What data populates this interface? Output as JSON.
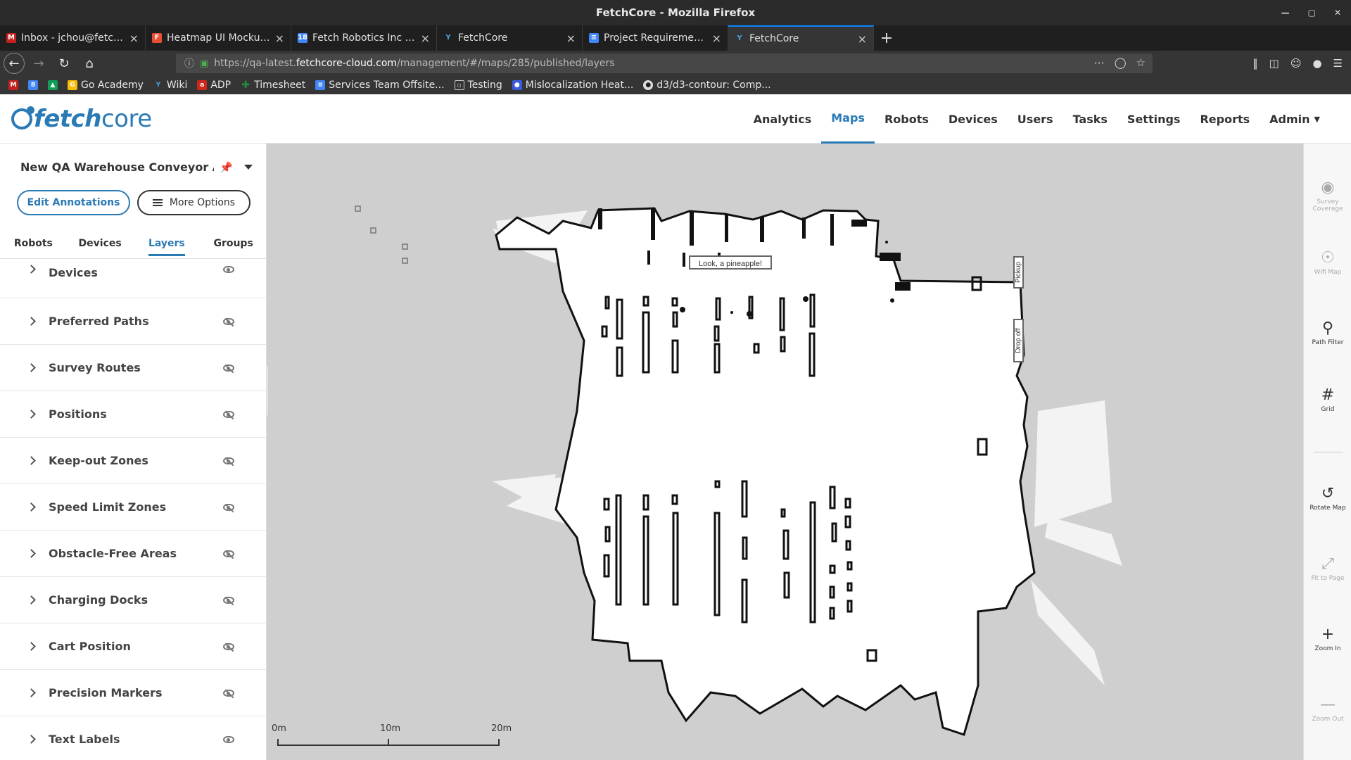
{
  "browser": {
    "window_title": "FetchCore - Mozilla Firefox",
    "tabs": [
      {
        "title": "Inbox - jchou@fetchrobo",
        "icon_color": "#c5221f",
        "active": false
      },
      {
        "title": "Heatmap UI Mockup – Fi",
        "icon_color": "#e94e35",
        "active": false
      },
      {
        "title": "Fetch Robotics Inc - Cale",
        "icon_color": "#4285f4",
        "active": false
      },
      {
        "title": "FetchCore",
        "icon_color": "#2a7ab5",
        "active": false
      },
      {
        "title": "Project Requirements &",
        "icon_color": "#4285f4",
        "active": false
      },
      {
        "title": "FetchCore",
        "icon_color": "#2a7ab5",
        "active": true
      }
    ],
    "url_prefix": "https://qa-latest.",
    "url_host": "fetchcore-cloud.com",
    "url_path": "/management/#/maps/285/published/layers",
    "bookmarks": [
      {
        "label": "",
        "icon_color": "#c5221f"
      },
      {
        "label": "",
        "icon_color": "#4285f4"
      },
      {
        "label": "",
        "icon_color": "#0f9d58"
      },
      {
        "label": "Go Academy",
        "icon_color": "#fbbc05"
      },
      {
        "label": "Wiki",
        "icon_color": "#2a7ab5"
      },
      {
        "label": "ADP",
        "icon_color": "#d0271d"
      },
      {
        "label": "Timesheet",
        "icon_color": "#1e8e3e"
      },
      {
        "label": "Services Team Offsite...",
        "icon_color": "#4285f4"
      },
      {
        "label": "Testing",
        "icon_color": "#888888"
      },
      {
        "label": "Mislocalization Heat...",
        "icon_color": "#3b5bdb"
      },
      {
        "label": "d3/d3-contour: Comp...",
        "icon_color": "#333333"
      }
    ]
  },
  "app": {
    "logo_fetch": "fetch",
    "logo_core": "core",
    "nav": [
      {
        "label": "Analytics",
        "active": false
      },
      {
        "label": "Maps",
        "active": true
      },
      {
        "label": "Robots",
        "active": false
      },
      {
        "label": "Devices",
        "active": false
      },
      {
        "label": "Users",
        "active": false
      },
      {
        "label": "Tasks",
        "active": false
      },
      {
        "label": "Settings",
        "active": false
      },
      {
        "label": "Reports",
        "active": false
      },
      {
        "label": "Admin",
        "active": false
      }
    ],
    "accent_color": "#2a7ab5"
  },
  "sidebar": {
    "map_title": "New QA Warehouse Conveyor Ar ...",
    "edit_annotations_label": "Edit Annotations",
    "more_options_label": "More Options",
    "tabs": [
      {
        "label": "Robots",
        "active": false
      },
      {
        "label": "Devices",
        "active": false
      },
      {
        "label": "Layers",
        "active": true
      },
      {
        "label": "Groups",
        "active": false
      }
    ],
    "layers": [
      {
        "label": "Devices",
        "visible": true
      },
      {
        "label": "Preferred Paths",
        "visible": false
      },
      {
        "label": "Survey Routes",
        "visible": false
      },
      {
        "label": "Positions",
        "visible": false
      },
      {
        "label": "Keep-out Zones",
        "visible": false
      },
      {
        "label": "Speed Limit Zones",
        "visible": false
      },
      {
        "label": "Obstacle-Free Areas",
        "visible": false
      },
      {
        "label": "Charging Docks",
        "visible": false
      },
      {
        "label": "Cart Position",
        "visible": false
      },
      {
        "label": "Precision Markers",
        "visible": false
      },
      {
        "label": "Text Labels",
        "visible": true
      }
    ]
  },
  "map": {
    "text_label": "Look, a pineapple!",
    "pickup_label": "Pickup",
    "dropoff_label": "Drop off",
    "scale_labels": [
      "0m",
      "10m",
      "20m"
    ]
  },
  "toolbar": {
    "tools": [
      {
        "label": "Survey Coverage",
        "icon": "survey-coverage-icon",
        "enabled": false
      },
      {
        "label": "Wifi Map",
        "icon": "wifi-icon",
        "enabled": false
      },
      {
        "label": "Path Filter",
        "icon": "path-filter-icon",
        "enabled": true
      },
      {
        "label": "Grid",
        "icon": "grid-icon",
        "enabled": true
      },
      {
        "label": "Rotate Map",
        "icon": "rotate-icon",
        "enabled": true
      },
      {
        "label": "Fit to Page",
        "icon": "fit-page-icon",
        "enabled": false
      },
      {
        "label": "Zoom In",
        "icon": "zoom-in-icon",
        "enabled": true
      },
      {
        "label": "Zoom Out",
        "icon": "zoom-out-icon",
        "enabled": false
      }
    ]
  }
}
